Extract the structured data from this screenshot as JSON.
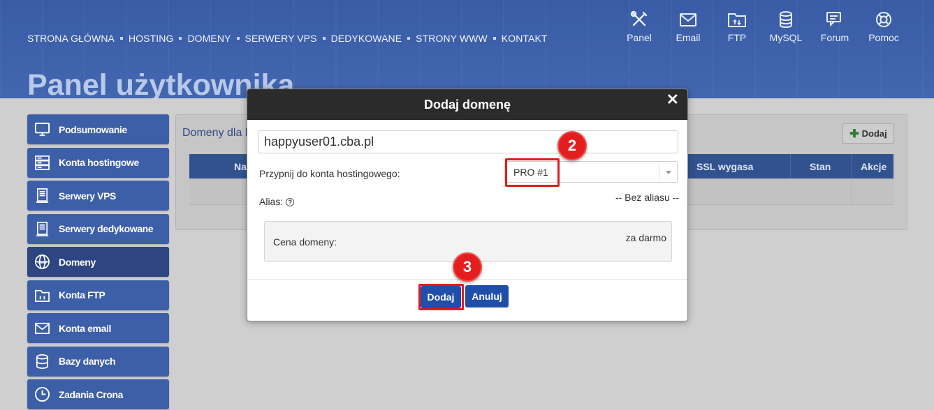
{
  "topnav": {
    "items": [
      "STRONA GŁÓWNA",
      "HOSTING",
      "DOMENY",
      "SERWERY VPS",
      "DEDYKOWANE",
      "STRONY WWW",
      "KONTAKT"
    ]
  },
  "quicklinks": [
    {
      "label": "Panel",
      "icon": "tools-icon"
    },
    {
      "label": "Email",
      "icon": "email-icon"
    },
    {
      "label": "FTP",
      "icon": "ftp-folder-icon"
    },
    {
      "label": "MySQL",
      "icon": "database-icon"
    },
    {
      "label": "Forum",
      "icon": "chat-icon"
    },
    {
      "label": "Pomoc",
      "icon": "lifebuoy-icon"
    }
  ],
  "page_title": "Panel użytkownika",
  "sidebar": {
    "items": [
      {
        "label": "Podsumowanie",
        "icon": "monitor-icon"
      },
      {
        "label": "Konta hostingowe",
        "icon": "server-icon"
      },
      {
        "label": "Serwery VPS",
        "icon": "vps-icon"
      },
      {
        "label": "Serwery dedykowane",
        "icon": "dedicated-server-icon"
      },
      {
        "label": "Domeny",
        "icon": "globe-www-icon",
        "active": true
      },
      {
        "label": "Konta FTP",
        "icon": "ftp-folder-icon"
      },
      {
        "label": "Konta email",
        "icon": "email-icon"
      },
      {
        "label": "Bazy danych",
        "icon": "database-icon"
      },
      {
        "label": "Zadania Crona",
        "icon": "clock-icon"
      }
    ]
  },
  "main": {
    "title": "Domeny dla k",
    "add_label": "Dodaj",
    "columns": {
      "name": "Na",
      "ssl": "SSL wygasa",
      "state": "Stan",
      "actions": "Akcje"
    }
  },
  "modal": {
    "title": "Dodaj domenę",
    "close": "✕",
    "domain_value": "happyuser01.cba.pl",
    "assign_label": "Przypnij do konta hostingowego:",
    "assign_value": "PRO #1",
    "alias_label": "Alias:",
    "alias_help": "?",
    "alias_value": "-- Bez aliasu --",
    "price_label": "Cena domeny:",
    "price_value": "za darmo",
    "add_button": "Dodaj",
    "cancel_button": "Anuluj"
  },
  "badges": {
    "step2": "2",
    "step3": "3"
  },
  "colors": {
    "brand": "#3d5fa8",
    "highlight": "#e11b1b",
    "button": "#1f4fa8",
    "modal_header": "#2b2b2b"
  }
}
